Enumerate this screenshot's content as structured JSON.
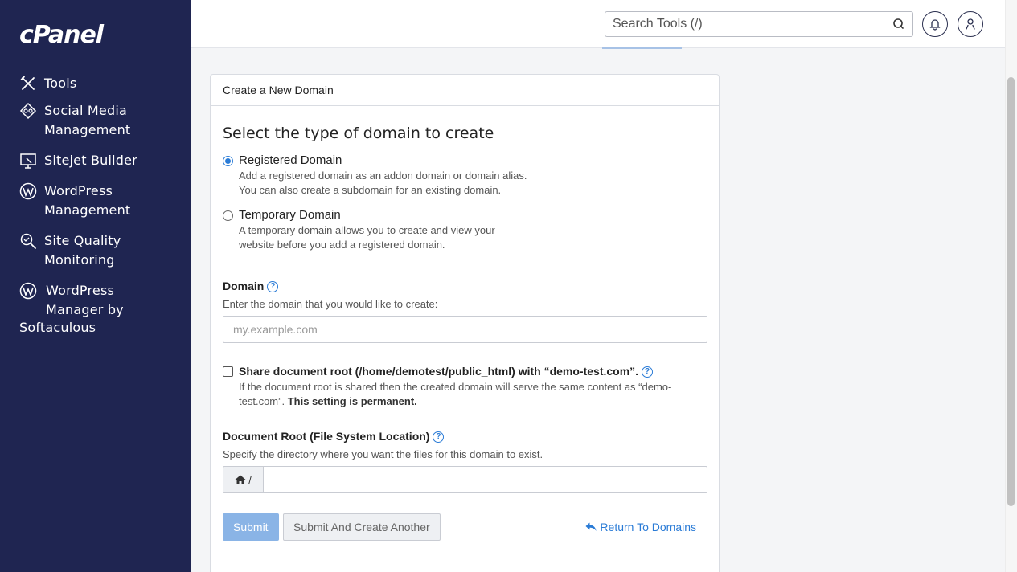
{
  "app": {
    "logo_text": "cPanel"
  },
  "search": {
    "placeholder": "Search Tools (/)"
  },
  "sidebar": {
    "items": [
      {
        "label": "Tools",
        "icon": "tools-icon"
      },
      {
        "label": "Social Media Management",
        "line1": "Social Media",
        "line2": "Management",
        "icon": "social-media-icon"
      },
      {
        "label": "Sitejet Builder",
        "icon": "sitejet-icon"
      },
      {
        "label": "WordPress Management",
        "line1": "WordPress",
        "line2": "Management",
        "icon": "wordpress-icon"
      },
      {
        "label": "Site Quality Monitoring",
        "line1": "Site Quality",
        "line2": "Monitoring",
        "icon": "site-quality-icon"
      },
      {
        "label": "WordPress Manager by Softaculous",
        "line1": "WordPress",
        "line2": "Manager by",
        "line3": "Softaculous",
        "icon": "wordpress-icon"
      }
    ]
  },
  "panel": {
    "header": "Create a New Domain",
    "heading": "Select the type of domain to create",
    "options": [
      {
        "title": "Registered Domain",
        "desc1": "Add a registered domain as an addon domain or domain alias.",
        "desc2": "You can also create a subdomain for an existing domain.",
        "selected": true
      },
      {
        "title": "Temporary Domain",
        "desc1": "A temporary domain allows you to create and view your",
        "desc2": "website before you add a registered domain.",
        "selected": false
      }
    ],
    "domain": {
      "label": "Domain",
      "hint": "Enter the domain that you would like to create:",
      "placeholder": "my.example.com",
      "value": ""
    },
    "share": {
      "label": "Share document root (/home/demotest/public_html) with “demo-test.com”.",
      "desc": "If the document root is shared then the created domain will serve the same content as “demo-test.com”.",
      "desc_bold": "This setting is permanent.",
      "checked": false
    },
    "docroot": {
      "label": "Document Root (File System Location)",
      "hint": "Specify the directory where you want the files for this domain to exist.",
      "prefix": "/",
      "value": ""
    },
    "buttons": {
      "submit": "Submit",
      "submit_another": "Submit And Create Another",
      "return": "Return To Domains"
    }
  },
  "colors": {
    "sidebar_bg": "#1f2551",
    "accent": "#2a7bd6",
    "submit_bg": "#8ab4e6"
  }
}
